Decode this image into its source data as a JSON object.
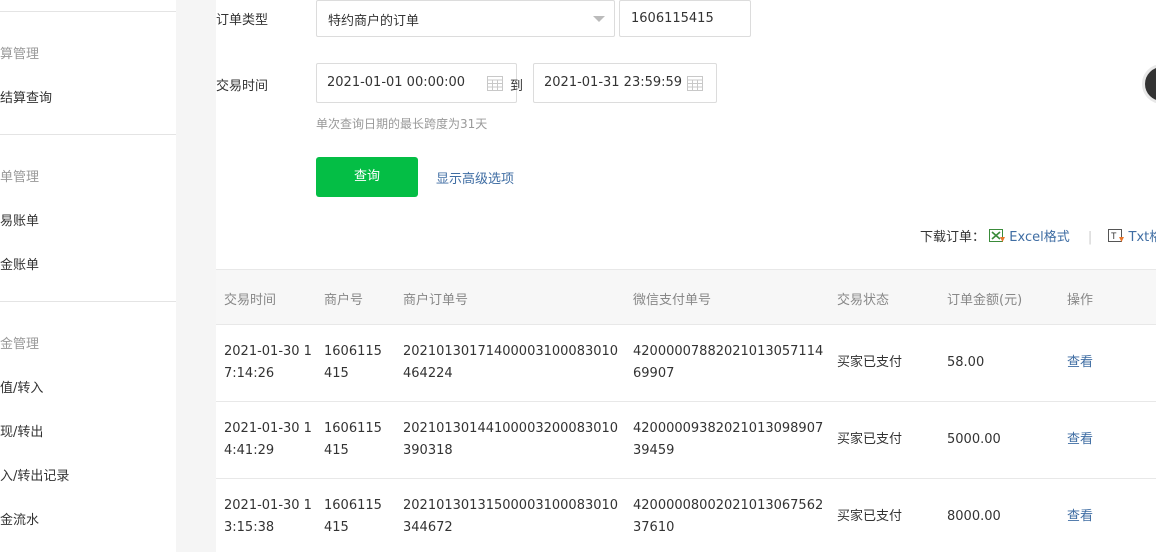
{
  "sidebar": {
    "groups": [
      {
        "title": "结算管理",
        "items": [
          "已结算查询"
        ]
      },
      {
        "title": "账单管理",
        "items": [
          "交易账单",
          "资金账单"
        ]
      },
      {
        "title": "资金管理",
        "items": [
          "充值/转入",
          "提现/转出",
          "转入/转出记录",
          "资金流水"
        ]
      }
    ]
  },
  "filters": {
    "order_type_label": "订单类型",
    "order_type_value": "特约商户的订单",
    "merchant_id_value": "1606115415",
    "trade_time_label": "交易时间",
    "start_time": "2021-01-01 00:00:00",
    "to_label": "到",
    "end_time": "2021-01-31 23:59:59",
    "hint": "单次查询日期的最长跨度为31天",
    "query_button": "查询",
    "advanced_link": "显示高级选项"
  },
  "download": {
    "label": "下载订单：",
    "excel": "Excel格式",
    "divider": "|",
    "txt": "Txt格"
  },
  "table": {
    "columns": [
      "交易时间",
      "商户号",
      "商户订单号",
      "微信支付单号",
      "交易状态",
      "订单金额(元)",
      "操作"
    ],
    "rows": [
      {
        "time": "2021-01-30 17:14:26",
        "merchant": "1606115415",
        "order_no": "20210130171400003100083010464224",
        "wx_no": "4200000788202101305711469907",
        "status": "买家已支付",
        "amount": "58.00",
        "action": "查看"
      },
      {
        "time": "2021-01-30 14:41:29",
        "merchant": "1606115415",
        "order_no": "20210130144100003200083010390318",
        "wx_no": "4200000938202101309890739459",
        "status": "买家已支付",
        "amount": "5000.00",
        "action": "查看"
      },
      {
        "time": "2021-01-30 13:15:38",
        "merchant": "1606115415",
        "order_no": "20210130131500003100083010344672",
        "wx_no": "4200000800202101306756237610",
        "status": "买家已支付",
        "amount": "8000.00",
        "action": "查看"
      }
    ]
  },
  "colors": {
    "primary_green": "#04be45",
    "link_blue": "#3f6da3",
    "muted": "#999999"
  }
}
